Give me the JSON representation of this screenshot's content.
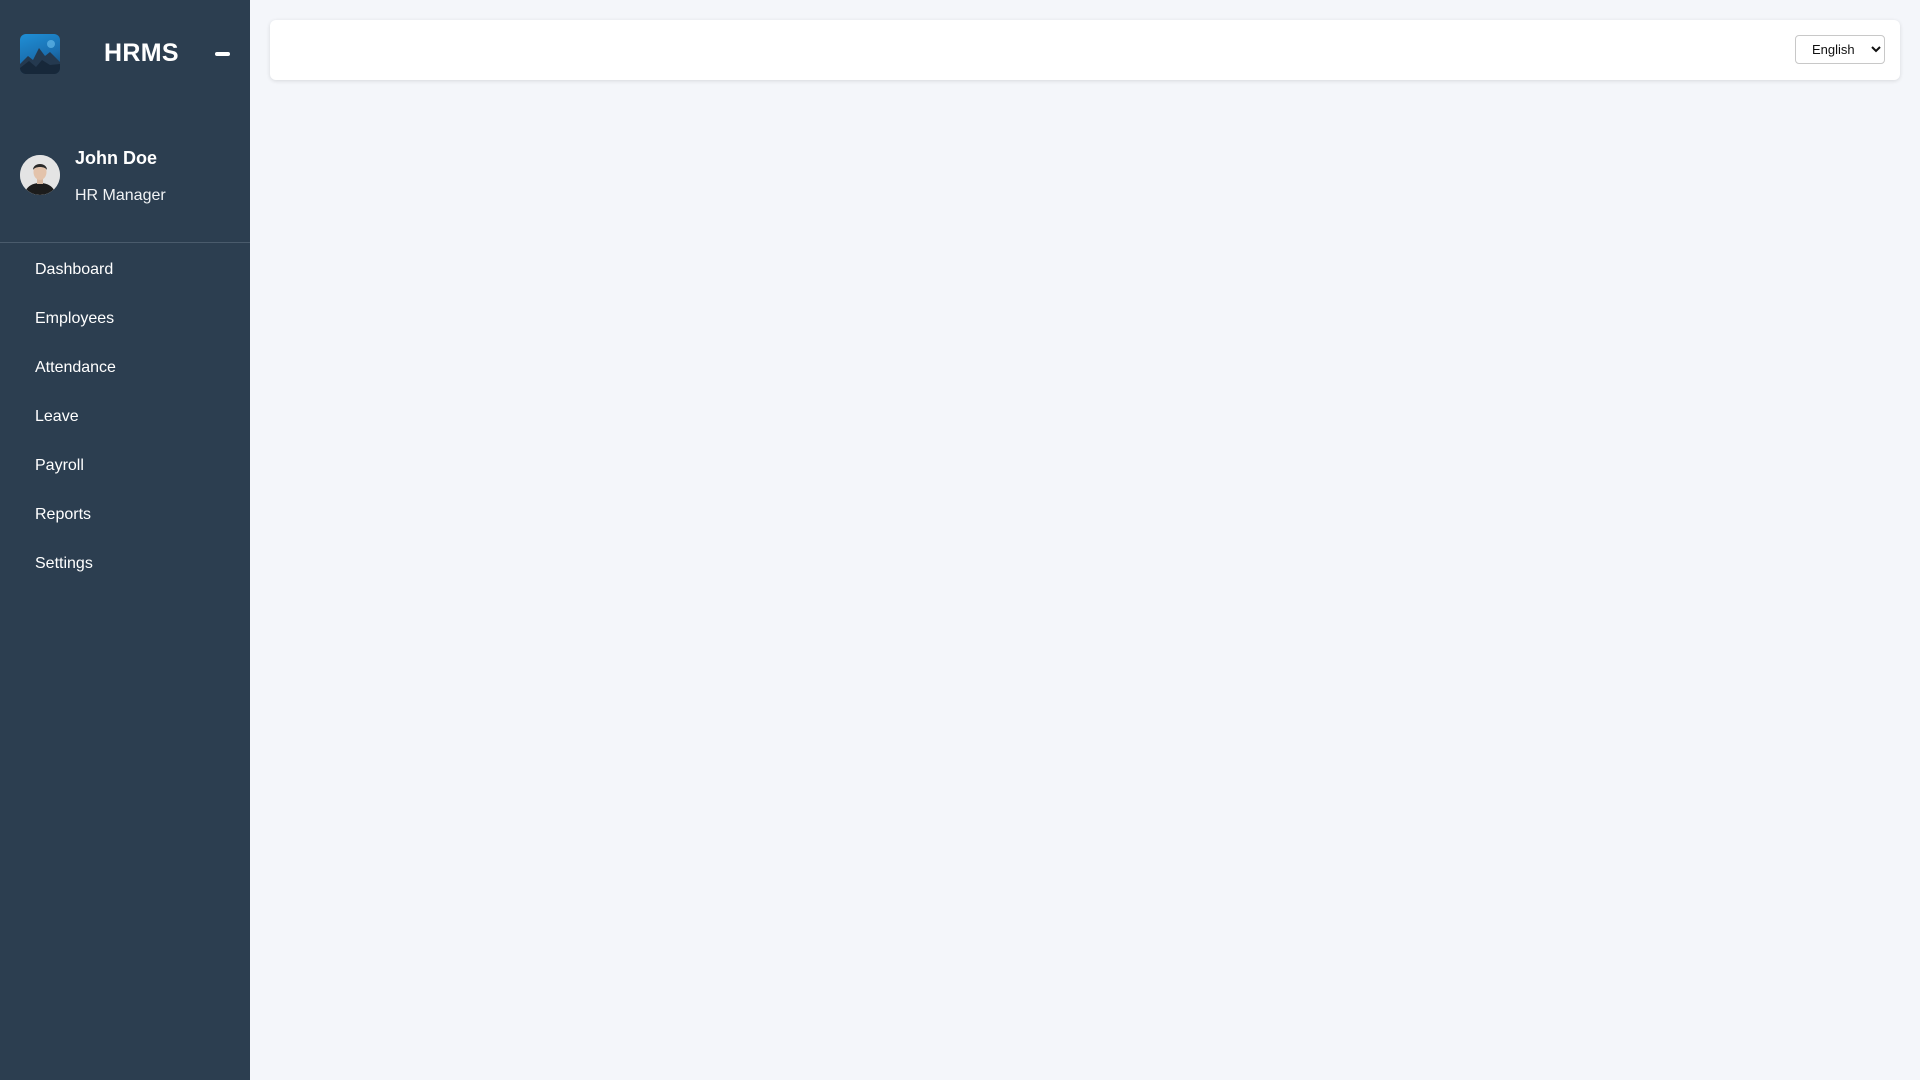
{
  "app": {
    "title": "HRMS"
  },
  "user": {
    "name": "John Doe",
    "role": "HR Manager"
  },
  "nav": {
    "items": [
      {
        "label": "Dashboard"
      },
      {
        "label": "Employees"
      },
      {
        "label": "Attendance"
      },
      {
        "label": "Leave"
      },
      {
        "label": "Payroll"
      },
      {
        "label": "Reports"
      },
      {
        "label": "Settings"
      }
    ]
  },
  "header": {
    "language": {
      "selected": "English",
      "options": [
        "English"
      ]
    }
  },
  "icons": {
    "logo": "app-logo",
    "collapse": "minus-icon",
    "avatar": "user-avatar"
  },
  "colors": {
    "sidebar": "#2c3e50",
    "background": "#f4f6fa",
    "card": "#ffffff",
    "text_light": "#ffffff"
  }
}
